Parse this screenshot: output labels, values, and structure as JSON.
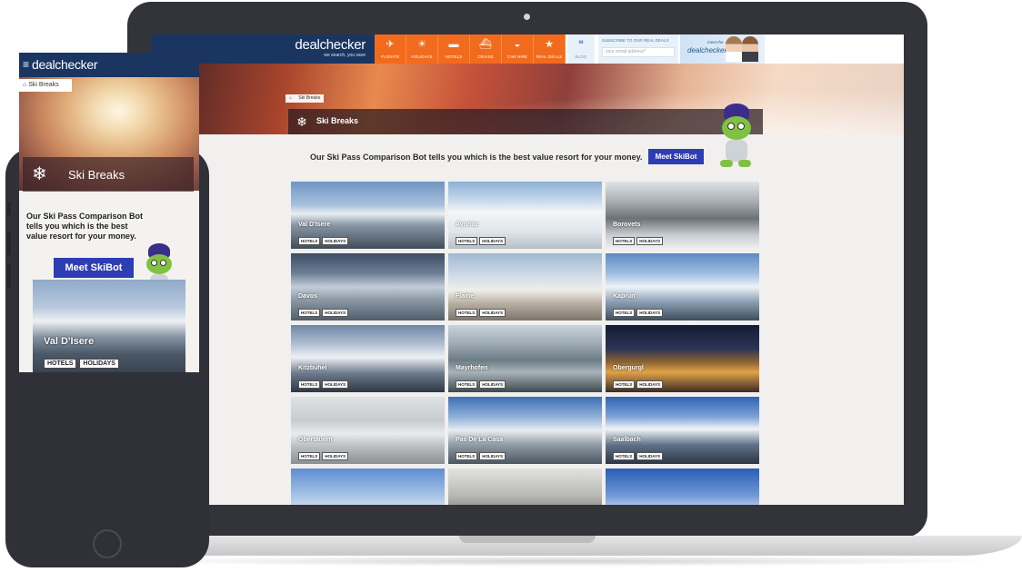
{
  "laptop": {
    "logo": "dealchecker",
    "tagline": "we search, you save",
    "nav": [
      {
        "label": "FLIGHTS",
        "icon": "plane-icon",
        "glyph": "✈"
      },
      {
        "label": "HOLIDAYS",
        "icon": "palm-tree-icon",
        "glyph": "☀"
      },
      {
        "label": "HOTELS",
        "icon": "bed-icon",
        "glyph": "▬"
      },
      {
        "label": "CRUISE",
        "icon": "ship-icon",
        "glyph": "⛴"
      },
      {
        "label": "CAR HIRE",
        "icon": "car-icon",
        "glyph": "◒"
      },
      {
        "label": "REAL DEALS",
        "icon": "star-icon",
        "glyph": "★"
      }
    ],
    "blog": {
      "label": "BLOG",
      "icon": "speech-bubble-icon",
      "glyph": "❝"
    },
    "subscribe": {
      "title": "SUBSCRIBE TO OUR REAL DEALS",
      "placeholder": "your email address*"
    },
    "meet": {
      "small": "meet the",
      "brand": "dealcheckers"
    },
    "breadcrumb": {
      "current": "Ski Breaks"
    },
    "page_title": "Ski Breaks",
    "bot_intro": "Our Ski Pass Comparison Bot tells you which is the best value resort for your money.",
    "meet_button": "Meet SkiBot",
    "tag_hotels": "HOTELS",
    "tag_holidays": "HOLIDAYS",
    "resorts": [
      {
        "name": "Val D'Isere",
        "bg": "linear-gradient(180deg,#6f95c4 0%,#a9c1dc 35%,#e9eef3 48%,#8896a5 65%,#414c58 100%)"
      },
      {
        "name": "Avoriaz",
        "bg": "linear-gradient(180deg,#8db1d8 0%,#cbdcec 30%,#f4f6f8 45%,#dfe5ea 75%,#b5bfc8 100%)"
      },
      {
        "name": "Borovets",
        "bg": "linear-gradient(180deg,#dfe3e6 0%,#a7adb3 30%,#6b7177 55%,#c9ced2 80%,#eef0f2 100%)"
      },
      {
        "name": "Davos",
        "bg": "linear-gradient(180deg,#3d4c63 0%,#6d7f96 30%,#c3cdd8 50%,#8a97a5 70%,#505c69 100%)"
      },
      {
        "name": "Flaine",
        "bg": "linear-gradient(180deg,#9fb8d3 0%,#d3dde7 35%,#efeee9 55%,#b7aea2 75%,#7c756c 100%)"
      },
      {
        "name": "Kaprun",
        "bg": "linear-gradient(180deg,#5e8bc4 0%,#9fbde0 30%,#eef3f8 50%,#8da0b3 72%,#3e4d5e 100%)"
      },
      {
        "name": "Kitzbuhel",
        "bg": "linear-gradient(180deg,#6f86a6 0%,#b4c3d5 30%,#eef1f4 48%,#6b7a8c 72%,#2e3744 100%)"
      },
      {
        "name": "Mayrhofen",
        "bg": "linear-gradient(180deg,#c9d3dc 0%,#9aa7b1 30%,#6b7b84 52%,#a9b3b9 70%,#3c4850 100%)"
      },
      {
        "name": "Obergurgl",
        "bg": "linear-gradient(180deg,#141c33 0%,#2a3456 35%,#8b6332 55%,#e0a247 70%,#3a2b24 100%)"
      },
      {
        "name": "Obertauern",
        "bg": "linear-gradient(180deg,#dfe2e4 0%,#c8ccce 35%,#e9ebec 55%,#b9bdbf 75%,#8a8f92 100%)"
      },
      {
        "name": "Pas De La Casa",
        "bg": "linear-gradient(180deg,#3c6fb5 0%,#8fb0d8 30%,#e8edf2 50%,#8f9aa4 72%,#4c5661 100%)"
      },
      {
        "name": "Saalbach",
        "bg": "linear-gradient(180deg,#2f63b5 0%,#7ea3d6 30%,#f1f4f7 48%,#5f7087 72%,#2c3645 100%)"
      },
      {
        "name": "",
        "bg": "linear-gradient(180deg,#5e8dd0 0%,#a6c2e6 40%,#e8eef5 70%,#b9c6d3 100%)"
      },
      {
        "name": "",
        "bg": "linear-gradient(180deg,#e2e2e0 0%,#b8b8b4 40%,#7a7a74 70%,#4d4d48 100%)"
      },
      {
        "name": "",
        "bg": "linear-gradient(180deg,#2a5db5 0%,#6f98d6 40%,#e9eef4 70%,#c2ccd6 100%)"
      }
    ]
  },
  "phone": {
    "logo": "dealchecker",
    "breadcrumb": "Ski Breaks",
    "page_title": "Ski Breaks",
    "bot_intro": "Our Ski Pass Comparison Bot tells you which is the best value resort for your money.",
    "meet_button": "Meet SkiBot",
    "tile": {
      "name": "Val D'Isere",
      "tags": [
        "HOTELS",
        "HOLIDAYS"
      ]
    }
  }
}
